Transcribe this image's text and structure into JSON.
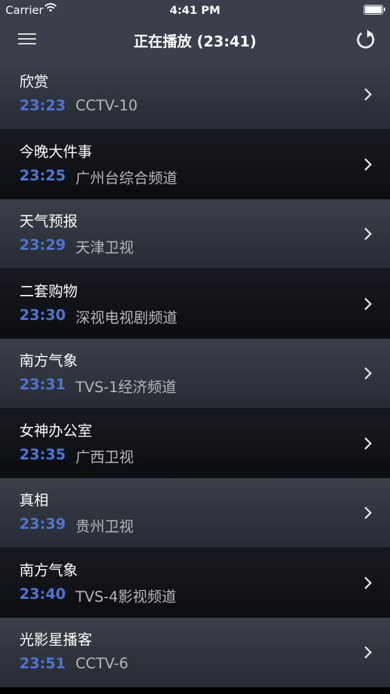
{
  "status_bar": {
    "carrier": "Carrier",
    "time": "4:41 PM",
    "wifi_icon": "wifi-icon",
    "battery_icon": "battery-icon"
  },
  "nav": {
    "title": "正在播放 (23:41)",
    "menu_icon": "hamburger-menu-icon",
    "refresh_icon": "refresh-icon"
  },
  "colors": {
    "time_accent": "#4f75d0",
    "channel_text": "#b4b6ba",
    "nav_background": "#3a3f4b"
  },
  "programs": [
    {
      "name": "欣赏",
      "time": "23:23",
      "channel": "CCTV-10"
    },
    {
      "name": "今晚大件事",
      "time": "23:25",
      "channel": "广州台综合频道"
    },
    {
      "name": "天气预报",
      "time": "23:29",
      "channel": "天津卫视"
    },
    {
      "name": "二套购物",
      "time": "23:30",
      "channel": "深视电视剧频道"
    },
    {
      "name": "南方气象",
      "time": "23:31",
      "channel": "TVS-1经济频道"
    },
    {
      "name": "女神办公室",
      "time": "23:35",
      "channel": "广西卫视"
    },
    {
      "name": "真相",
      "time": "23:39",
      "channel": "贵州卫视"
    },
    {
      "name": "南方气象",
      "time": "23:40",
      "channel": "TVS-4影视频道"
    },
    {
      "name": "光影星播客",
      "time": "23:51",
      "channel": "CCTV-6"
    }
  ]
}
